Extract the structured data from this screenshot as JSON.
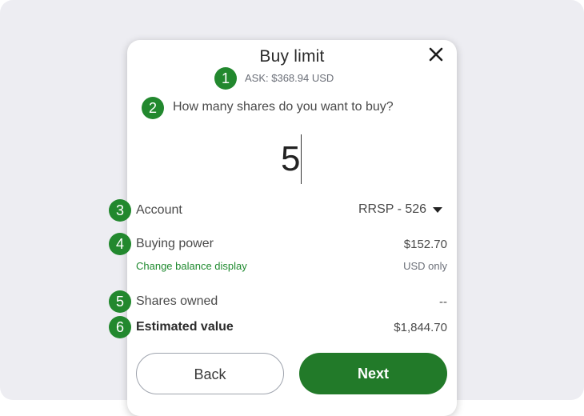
{
  "dialog": {
    "title": "Buy limit",
    "ask": "ASK: $368.94 USD",
    "question": "How many shares do you want to buy?",
    "quantity": "5"
  },
  "badges": [
    "1",
    "2",
    "3",
    "4",
    "5",
    "6"
  ],
  "account": {
    "label": "Account",
    "value": "RRSP - 526"
  },
  "buying_power": {
    "label": "Buying power",
    "value": "$152.70",
    "change_link": "Change balance display",
    "display_mode": "USD only"
  },
  "shares_owned": {
    "label": "Shares owned",
    "value": "--"
  },
  "estimated_value": {
    "label": "Estimated value",
    "value": "$1,844.70"
  },
  "buttons": {
    "back": "Back",
    "next": "Next"
  },
  "colors": {
    "accent_green": "#227a29",
    "badge_green": "#22882e",
    "link_green": "#1f8a2f",
    "backdrop": "#ededf2"
  },
  "icons": {
    "close": "close-icon",
    "dropdown": "chevron-down-icon"
  }
}
